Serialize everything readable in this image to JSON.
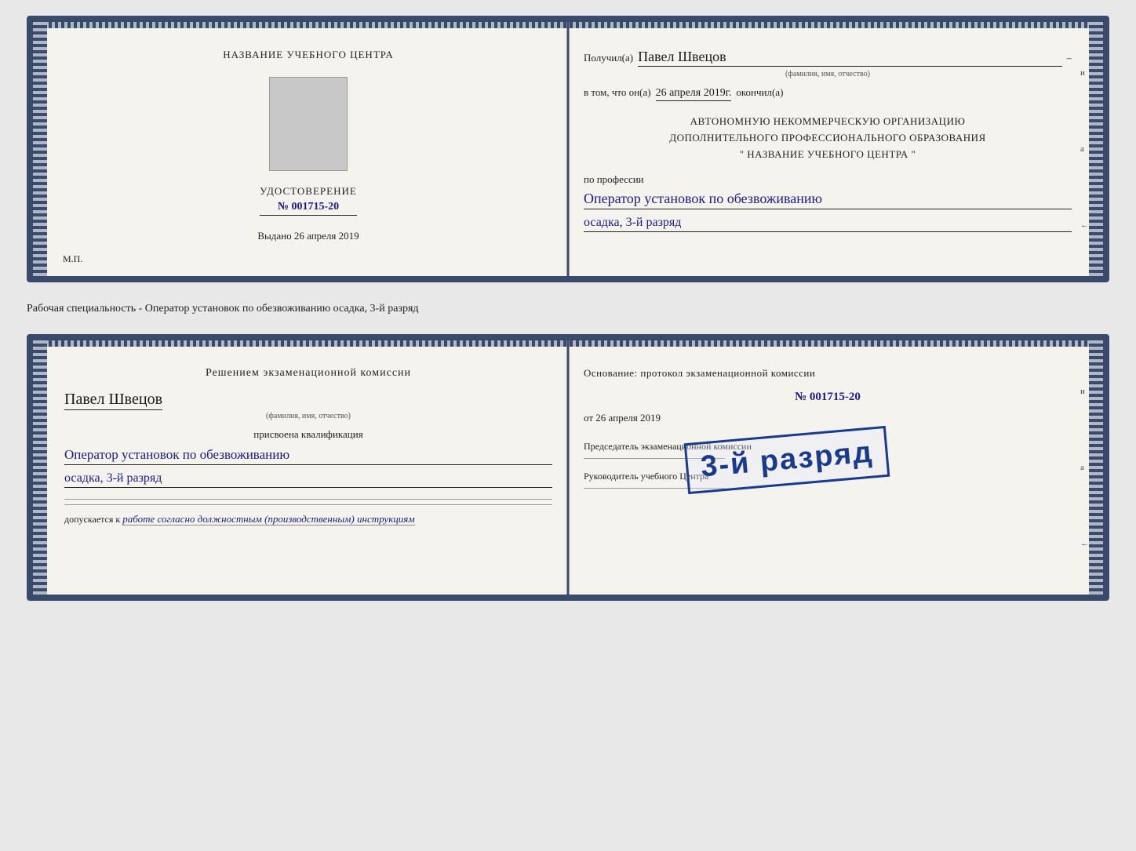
{
  "card1": {
    "left": {
      "title": "НАЗВАНИЕ УЧЕБНОГО ЦЕНТРА",
      "udostoverenie_label": "УДОСТОВЕРЕНИЕ",
      "cert_number": "№ 001715-20",
      "vydano_label": "Выдано",
      "vydano_date": "26 апреля 2019",
      "mp_label": "М.П."
    },
    "right": {
      "poluchil": "Получил(а)",
      "name": "Павел Швецов",
      "fio_subtitle": "(фамилия, имя, отчество)",
      "dash": "–",
      "vtom": "в том, что он(а)",
      "date_handwritten": "26 апреля 2019г.",
      "okonchil": "окончил(а)",
      "org_line1": "АВТОНОМНУЮ НЕКОММЕРЧЕСКУЮ ОРГАНИЗАЦИЮ",
      "org_line2": "ДОПОЛНИТЕЛЬНОГО ПРОФЕССИОНАЛЬНОГО ОБРАЗОВАНИЯ",
      "org_line3": "\" НАЗВАНИЕ УЧЕБНОГО ЦЕНТРА \"",
      "po_professii": "по профессии",
      "profession": "Оператор установок по обезвоживанию",
      "razryad": "осадка, 3-й разряд"
    }
  },
  "separator": {
    "text": "Рабочая специальность - Оператор установок по обезвоживанию осадка, 3-й разряд"
  },
  "card2": {
    "left": {
      "resheniem": "Решением экзаменационной комиссии",
      "name": "Павел Швецов",
      "fio_subtitle": "(фамилия, имя, отчество)",
      "prisvoena": "присвоена квалификация",
      "profession": "Оператор установок по обезвоживанию",
      "razryad": "осадка, 3-й разряд",
      "dopuskaetsya": "допускается к",
      "dopusk_text": "работе согласно должностным (производственным) инструкциям"
    },
    "right": {
      "osnovanie": "Основание: протокол экзаменационной комиссии",
      "number": "№ 001715-20",
      "ot_label": "от",
      "ot_date": "26 апреля 2019",
      "predsedatel": "Председатель экзаменационной комиссии",
      "rukovoditel": "Руководитель учебного Центра"
    },
    "stamp": {
      "text": "3-й разряд"
    }
  },
  "edge_chars": {
    "right1": "и",
    "right2": "а",
    "right3": "←"
  }
}
